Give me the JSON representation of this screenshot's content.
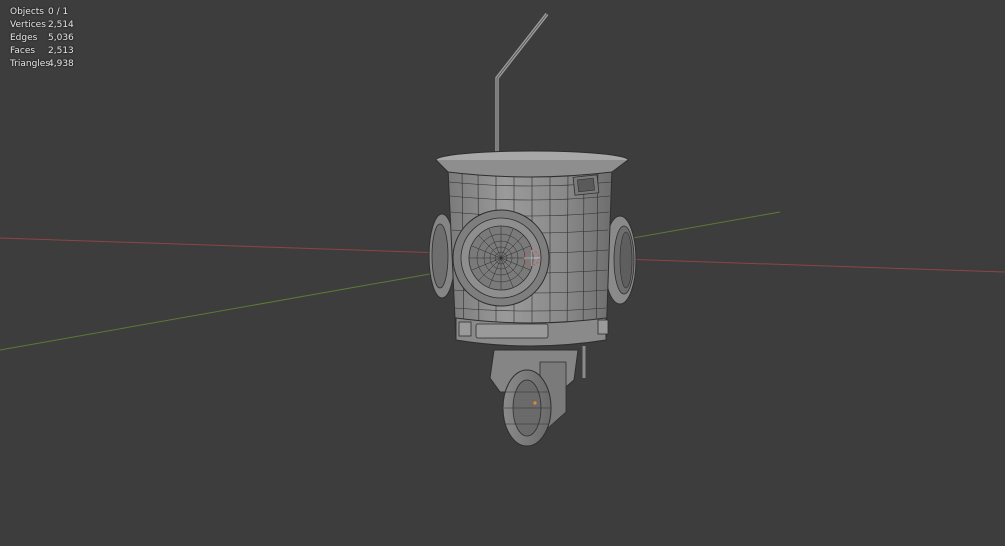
{
  "viewport": {
    "background": "#3d3d3d",
    "x_axis_color": "#9a4a4a",
    "y_axis_color": "#6a8a3e",
    "wire_color": "#2e2e2e",
    "mesh_color": "#8e8e8e"
  },
  "stats": [
    {
      "label": "Objects",
      "value": "0 / 1"
    },
    {
      "label": "Vertices",
      "value": "2,514"
    },
    {
      "label": "Edges",
      "value": "5,036"
    },
    {
      "label": "Faces",
      "value": "2,513"
    },
    {
      "label": "Triangles",
      "value": "4,938"
    }
  ]
}
